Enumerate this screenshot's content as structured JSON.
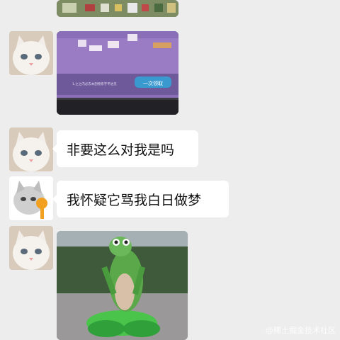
{
  "messages": [
    {
      "type": "image",
      "image_text": "",
      "button_label": ""
    },
    {
      "type": "image",
      "image_text": "1.之之内必去本剖物系字平进见",
      "button_label": "一次领取"
    },
    {
      "type": "text",
      "text": "非要这么对我是吗"
    },
    {
      "type": "text",
      "text": "我怀疑它骂我白日做梦"
    },
    {
      "type": "image",
      "image_text": "",
      "button_label": ""
    }
  ],
  "watermark": "@稀土掘金技术社区"
}
